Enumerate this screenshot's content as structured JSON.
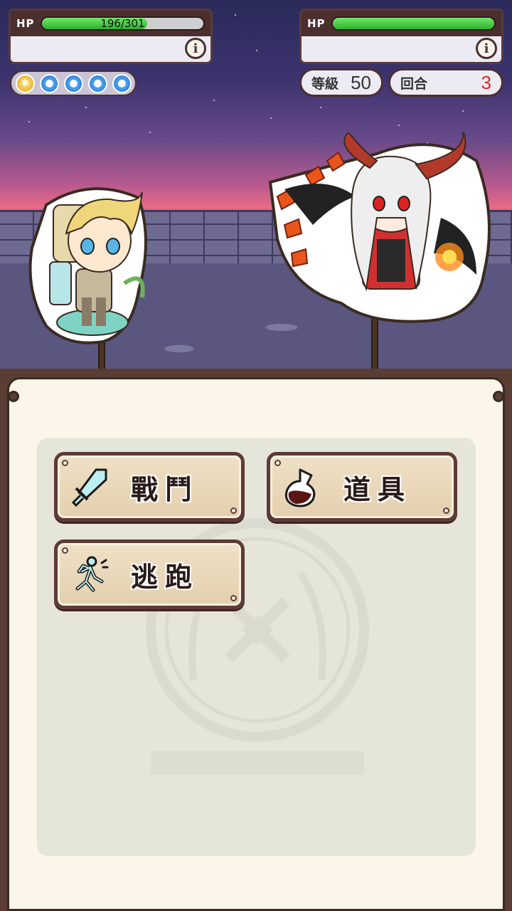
{
  "player": {
    "hp_label": "HP",
    "hp_text": "196/301",
    "hp_fraction": 0.651,
    "info_icon": "info-icon",
    "orbs": [
      "sun-orb-icon",
      "water-orb-icon",
      "water-orb-icon",
      "water-orb-icon",
      "water-orb-icon"
    ]
  },
  "enemy": {
    "hp_label": "HP",
    "hp_fraction": 1.0,
    "info_icon": "info-icon",
    "level_label": "等級",
    "level_value": "50",
    "round_label": "回合",
    "round_value": "3"
  },
  "commands": {
    "fight_label": "戰鬥",
    "item_label": "道具",
    "escape_label": "逃跑"
  },
  "colors": {
    "hp_green": "#3cc43a",
    "frame_brown": "#4b2f2f",
    "round_red": "#e02626",
    "panel_cream": "#fbf6e9"
  }
}
